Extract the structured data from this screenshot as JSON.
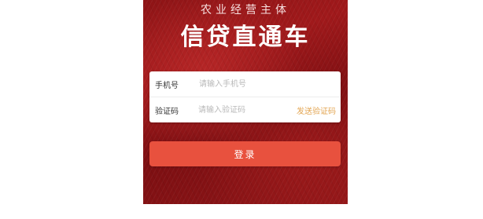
{
  "header": {
    "subtitle": "农业经营主体",
    "title": "信贷直通车"
  },
  "form": {
    "phone": {
      "label": "手机号",
      "placeholder": "请输入手机号",
      "value": ""
    },
    "code": {
      "label": "验证码",
      "placeholder": "请输入验证码",
      "value": "",
      "send_code_label": "发送验证码"
    },
    "login_label": "登录"
  },
  "colors": {
    "background": "#9a1719",
    "login_button": "#e8513e",
    "send_code_link": "#e3a552",
    "placeholder": "#b9b9b9"
  }
}
